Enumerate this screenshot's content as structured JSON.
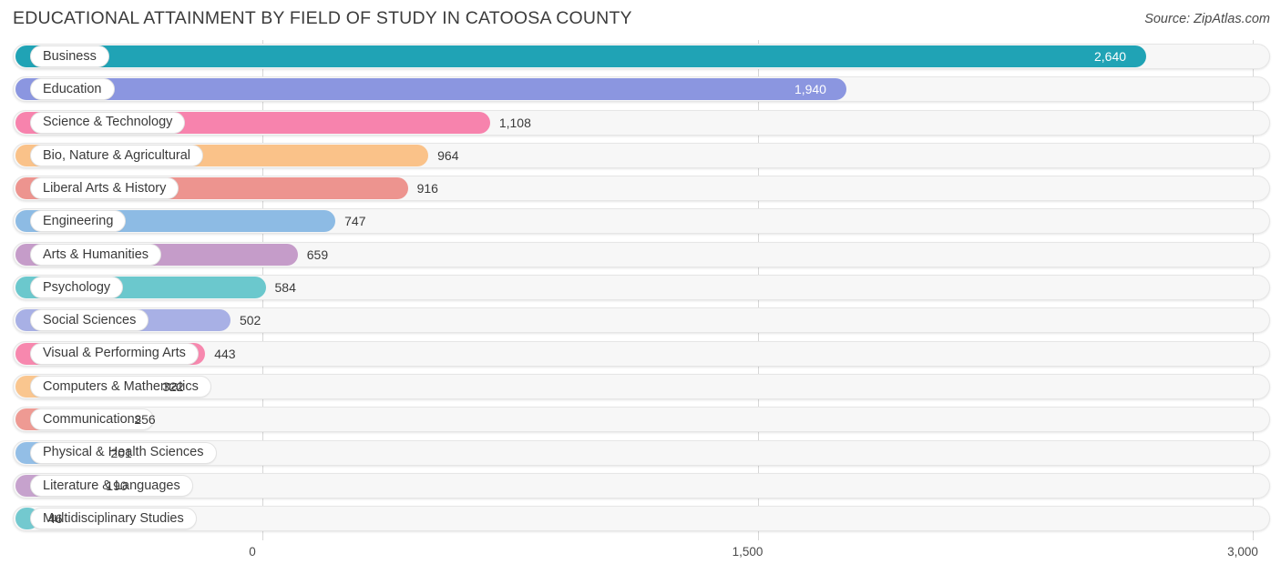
{
  "header": {
    "title": "EDUCATIONAL ATTAINMENT BY FIELD OF STUDY IN CATOOSA COUNTY",
    "source": "Source: ZipAtlas.com"
  },
  "chart_data": {
    "type": "bar",
    "orientation": "horizontal",
    "title": "EDUCATIONAL ATTAINMENT BY FIELD OF STUDY IN CATOOSA COUNTY",
    "xlabel": "",
    "ylabel": "",
    "xlim": [
      0,
      3000
    ],
    "xticks": [
      "0",
      "1,500",
      "3,000"
    ],
    "xtick_values": [
      0,
      1500,
      3000
    ],
    "grid": true,
    "legend": "none",
    "categories": [
      "Business",
      "Education",
      "Science & Technology",
      "Bio, Nature & Agricultural",
      "Liberal Arts & History",
      "Engineering",
      "Arts & Humanities",
      "Psychology",
      "Social Sciences",
      "Visual & Performing Arts",
      "Computers & Mathematics",
      "Communications",
      "Physical & Health Sciences",
      "Literature & Languages",
      "Multidisciplinary Studies"
    ],
    "values": [
      2640,
      1940,
      1108,
      964,
      916,
      747,
      659,
      584,
      502,
      443,
      322,
      256,
      201,
      190,
      46
    ],
    "value_labels": [
      "2,640",
      "1,940",
      "1,108",
      "964",
      "916",
      "747",
      "659",
      "584",
      "502",
      "443",
      "322",
      "256",
      "201",
      "190",
      "46"
    ],
    "colors": [
      "#20a3b5",
      "#8b96e0",
      "#f783ad",
      "#fac289",
      "#ed948f",
      "#8dbbe4",
      "#c59cc9",
      "#6bc8cd",
      "#a8b0e5",
      "#f788ae",
      "#fac68f",
      "#ee9a93",
      "#93bee6",
      "#c6a2cd",
      "#73c9cf"
    ],
    "label_inside": [
      true,
      true,
      false,
      false,
      false,
      false,
      false,
      false,
      false,
      false,
      false,
      false,
      false,
      false,
      false
    ]
  },
  "rows": [
    {
      "label": "Business",
      "value_label": "2,640",
      "value": 2640,
      "color": "#20a3b5",
      "inside": true
    },
    {
      "label": "Education",
      "value_label": "1,940",
      "value": 1940,
      "color": "#8b96e0",
      "inside": true
    },
    {
      "label": "Science & Technology",
      "value_label": "1,108",
      "value": 1108,
      "color": "#f783ad",
      "inside": false
    },
    {
      "label": "Bio, Nature & Agricultural",
      "value_label": "964",
      "value": 964,
      "color": "#fac289",
      "inside": false
    },
    {
      "label": "Liberal Arts & History",
      "value_label": "916",
      "value": 916,
      "color": "#ed948f",
      "inside": false
    },
    {
      "label": "Engineering",
      "value_label": "747",
      "value": 747,
      "color": "#8dbbe4",
      "inside": false
    },
    {
      "label": "Arts & Humanities",
      "value_label": "659",
      "value": 659,
      "color": "#c59cc9",
      "inside": false
    },
    {
      "label": "Psychology",
      "value_label": "584",
      "value": 584,
      "color": "#6bc8cd",
      "inside": false
    },
    {
      "label": "Social Sciences",
      "value_label": "502",
      "value": 502,
      "color": "#a8b0e5",
      "inside": false
    },
    {
      "label": "Visual & Performing Arts",
      "value_label": "443",
      "value": 443,
      "color": "#f788ae",
      "inside": false
    },
    {
      "label": "Computers & Mathematics",
      "value_label": "322",
      "value": 322,
      "color": "#fac68f",
      "inside": false
    },
    {
      "label": "Communications",
      "value_label": "256",
      "value": 256,
      "color": "#ee9a93",
      "inside": false
    },
    {
      "label": "Physical & Health Sciences",
      "value_label": "201",
      "value": 201,
      "color": "#93bee6",
      "inside": false
    },
    {
      "label": "Literature & Languages",
      "value_label": "190",
      "value": 190,
      "color": "#c6a2cd",
      "inside": false
    },
    {
      "label": "Multidisciplinary Studies",
      "value_label": "46",
      "value": 46,
      "color": "#73c9cf",
      "inside": false
    }
  ],
  "xaxis": {
    "ticks": [
      {
        "label": "0",
        "value": 0
      },
      {
        "label": "1,500",
        "value": 1500
      },
      {
        "label": "3,000",
        "value": 3000
      }
    ]
  }
}
